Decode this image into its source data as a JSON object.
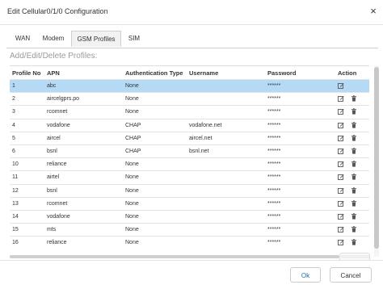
{
  "dialog": {
    "title": "Edit Cellular0/1/0 Configuration",
    "close_glyph": "×"
  },
  "tabs": [
    {
      "label": "WAN"
    },
    {
      "label": "Modem"
    },
    {
      "label": "GSM Profiles",
      "active": true
    },
    {
      "label": "SIM"
    }
  ],
  "section_label": "Add/Edit/Delete Profiles:",
  "table": {
    "headers": {
      "profile_no": "Profile No",
      "apn": "APN",
      "auth": "Authentication Type",
      "username": "Username",
      "password": "Password",
      "action": "Action"
    },
    "rows": [
      {
        "no": "1",
        "apn": "abc",
        "auth": "None",
        "user": "",
        "pw": "******",
        "selected": true,
        "deletable": false
      },
      {
        "no": "2",
        "apn": "aircelgprs.po",
        "auth": "None",
        "user": "",
        "pw": "******",
        "deletable": true
      },
      {
        "no": "3",
        "apn": "rcomnet",
        "auth": "None",
        "user": "",
        "pw": "******",
        "deletable": true
      },
      {
        "no": "4",
        "apn": "vodafone",
        "auth": "CHAP",
        "user": "vodafone.net",
        "pw": "******",
        "deletable": true
      },
      {
        "no": "5",
        "apn": "aircel",
        "auth": "CHAP",
        "user": "aircel.net",
        "pw": "******",
        "deletable": true
      },
      {
        "no": "6",
        "apn": "bsnl",
        "auth": "CHAP",
        "user": "bsnl.net",
        "pw": "******",
        "deletable": true
      },
      {
        "no": "10",
        "apn": "reliance",
        "auth": "None",
        "user": "",
        "pw": "******",
        "deletable": true
      },
      {
        "no": "11",
        "apn": "airtel",
        "auth": "None",
        "user": "",
        "pw": "******",
        "deletable": true
      },
      {
        "no": "12",
        "apn": "bsnl",
        "auth": "None",
        "user": "",
        "pw": "******",
        "deletable": true
      },
      {
        "no": "13",
        "apn": "rcomnet",
        "auth": "None",
        "user": "",
        "pw": "******",
        "deletable": true
      },
      {
        "no": "14",
        "apn": "vodafone",
        "auth": "None",
        "user": "",
        "pw": "******",
        "deletable": true
      },
      {
        "no": "15",
        "apn": "mts",
        "auth": "None",
        "user": "",
        "pw": "******",
        "deletable": true
      },
      {
        "no": "16",
        "apn": "reliance",
        "auth": "None",
        "user": "",
        "pw": "******",
        "deletable": true
      }
    ]
  },
  "footer": {
    "ok_label": "Ok",
    "cancel_label": "Cancel"
  },
  "colors": {
    "selected_row": "#b4daf6",
    "ok_text": "#1a6fb3"
  },
  "icons": {
    "edit": "edit-icon",
    "delete": "trash-icon",
    "close": "close-icon"
  }
}
